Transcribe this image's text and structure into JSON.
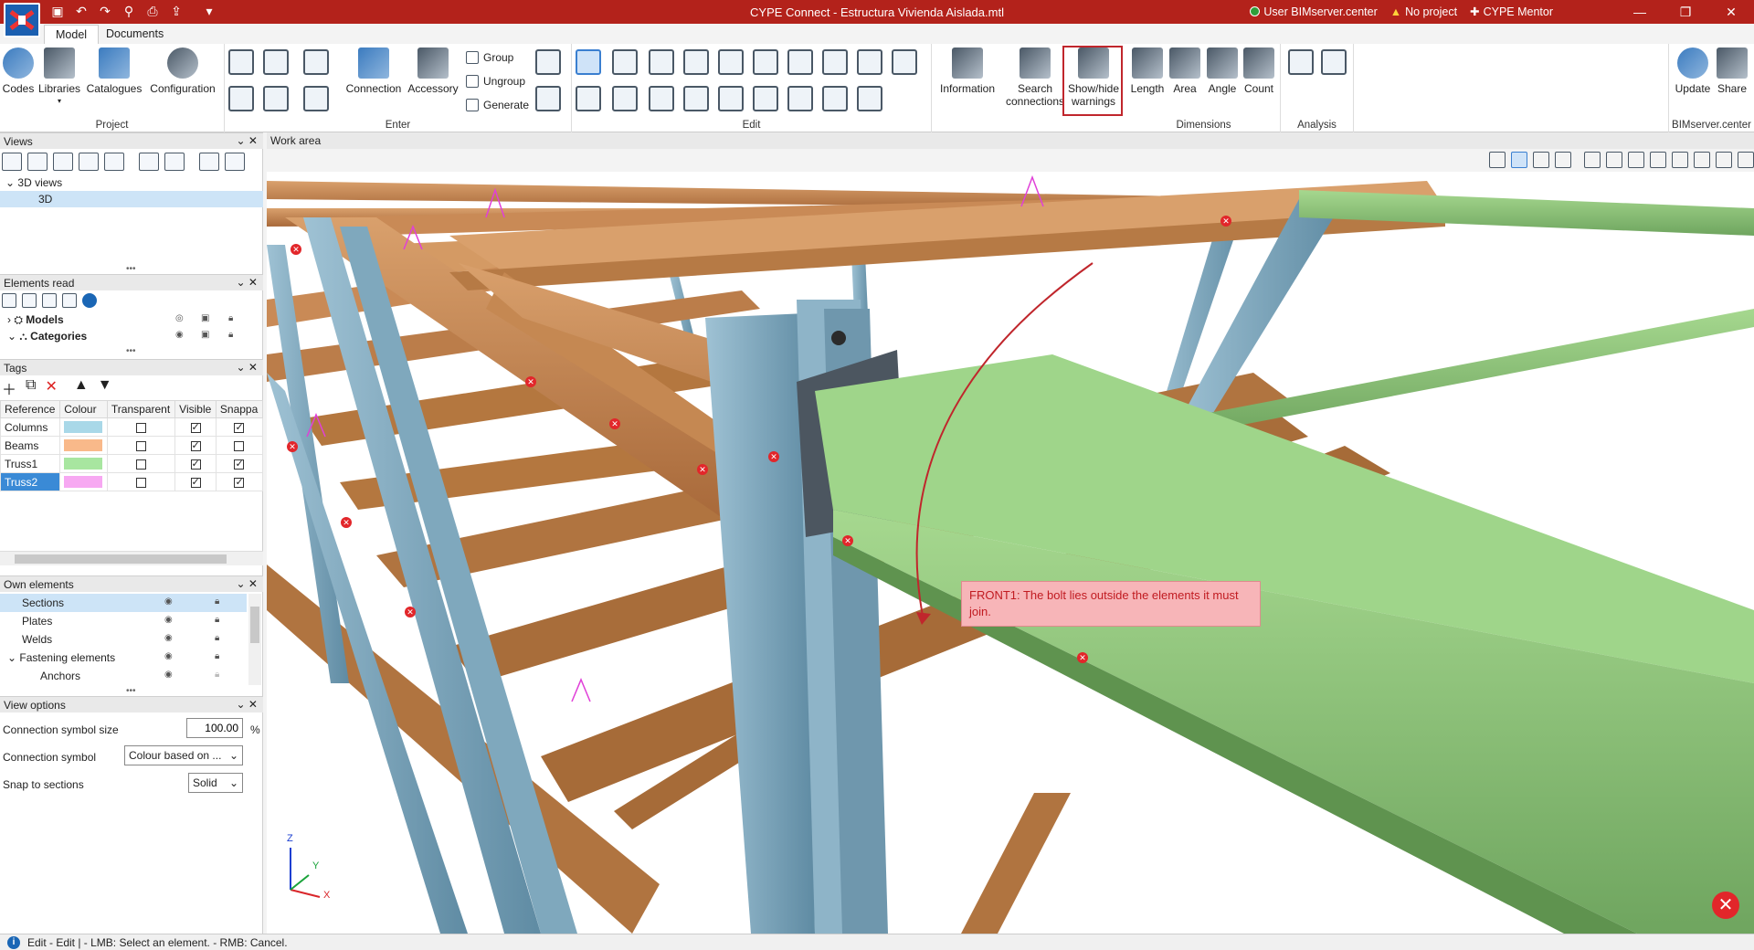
{
  "window": {
    "title": "CYPE Connect - Estructura Vivienda Aislada.mtl",
    "user": "User BIMserver.center",
    "project": "No project",
    "mentor": "CYPE Mentor"
  },
  "ribbon_tabs": [
    "Model",
    "Documents"
  ],
  "ribbon": {
    "project": {
      "title": "Project",
      "codes": "Codes",
      "libraries": "Libraries",
      "catalogues": "Catalogues",
      "configuration": "Configuration"
    },
    "enter": {
      "title": "Enter",
      "connection": "Connection",
      "accessory": "Accessory",
      "group": "Group",
      "ungroup": "Ungroup",
      "generate": "Generate"
    },
    "edit": {
      "title": "Edit"
    },
    "information": "Information",
    "search_connections": [
      "Search",
      "connections"
    ],
    "show_hide_warnings": [
      "Show/hide",
      "warnings"
    ],
    "dimensions": {
      "title": "Dimensions",
      "length": "Length",
      "area": "Area",
      "angle": "Angle",
      "count": "Count"
    },
    "analysis": {
      "title": "Analysis"
    },
    "bim": {
      "title": "BIMserver.center",
      "update": "Update",
      "share": "Share"
    }
  },
  "panels": {
    "views": {
      "title": "Views",
      "group": "3D views",
      "item": "3D"
    },
    "elements_read": {
      "title": "Elements read",
      "models": "Models",
      "categories": "Categories"
    },
    "tags": {
      "title": "Tags",
      "columns": [
        "Reference",
        "Colour",
        "Transparent",
        "Visible",
        "Snappa"
      ],
      "rows": [
        {
          "ref": "Columns",
          "color": "#a9d8e8",
          "transparent": false,
          "visible": true,
          "snap": true
        },
        {
          "ref": "Beams",
          "color": "#f9b98a",
          "transparent": false,
          "visible": true,
          "snap": false
        },
        {
          "ref": "Truss1",
          "color": "#a8e6a0",
          "transparent": false,
          "visible": true,
          "snap": true
        },
        {
          "ref": "Truss2",
          "color": "#f7a8f2",
          "transparent": false,
          "visible": true,
          "snap": true
        }
      ]
    },
    "own_elements": {
      "title": "Own elements",
      "rows": [
        "Sections",
        "Plates",
        "Welds",
        "Fastening elements",
        "Anchors"
      ]
    },
    "view_options": {
      "title": "View options",
      "symbol_size_label": "Connection symbol size",
      "symbol_size_value": "100.00",
      "symbol_size_unit": "%",
      "symbol_label": "Connection symbol",
      "symbol_value": "Colour based on ...",
      "snap_label": "Snap to sections",
      "snap_value": "Solid"
    }
  },
  "work_area": {
    "title": "Work area"
  },
  "tooltip": "FRONT1: The bolt lies outside the elements it must join.",
  "axes": {
    "z": "Z",
    "y": "Y",
    "x": "X"
  },
  "status": "Edit - Edit  |  - LMB: Select an element. - RMB: Cancel.",
  "colors": {
    "titlebar": "#b3221b",
    "beam": "#c98a56",
    "column": "#7fa8bd",
    "truss": "#8cc47c",
    "warning": "#e2262a"
  }
}
